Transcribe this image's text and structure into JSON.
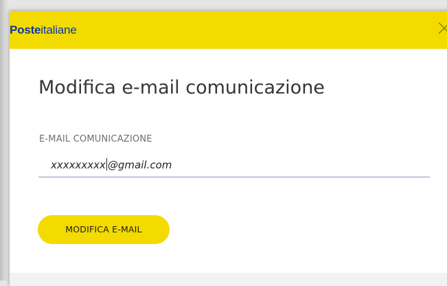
{
  "header": {
    "logo_bold": "Poste",
    "logo_light": "italiane",
    "close_icon": "close-icon",
    "background_color": "#f3db00",
    "brand_color": "#0b3aa6"
  },
  "dialog": {
    "title": "Modifica e-mail comunicazione",
    "field_label": "E-MAIL COMUNICAZIONE",
    "email_value": {
      "before_caret": "xxxxxxxxx",
      "after_caret": "@gmail.com"
    },
    "submit_label": "MODIFICA E-MAIL"
  }
}
